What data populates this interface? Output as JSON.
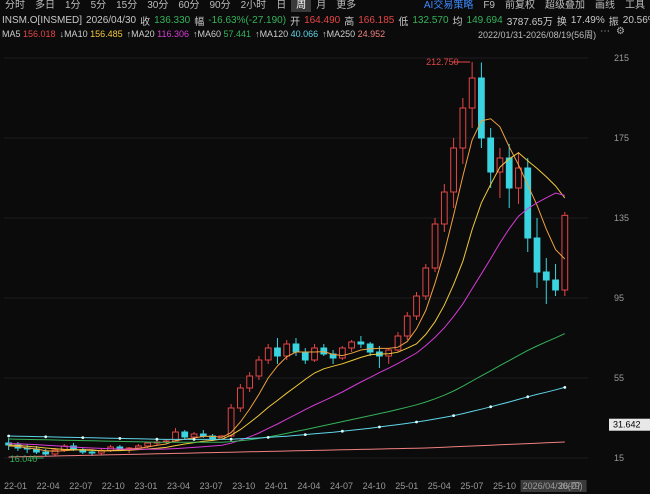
{
  "toolbar": {
    "tabs": [
      "分时",
      "多日",
      "1分",
      "5分",
      "15分",
      "30分",
      "60分",
      "90分",
      "2小时",
      "日",
      "周",
      "月",
      "更多"
    ],
    "active_tab": "周",
    "right": [
      "AI交易策略",
      "F9",
      "前复权",
      "超级叠加",
      "画线",
      "工具"
    ]
  },
  "quote": {
    "symbol": "INSM.O[INSMED]",
    "date": "2026/04/30",
    "close_label": "收",
    "close": "136.330",
    "change_label": "幅",
    "change": "-16.63%(-27.190)",
    "open_label": "开",
    "open": "164.490",
    "high_label": "高",
    "high": "166.185",
    "low_label": "低",
    "low": "132.570",
    "avg_label": "均",
    "avg": "149.694",
    "volume": "3787.65万",
    "turnover_label": "换",
    "turnover": "17.49%",
    "amplitude_label": "振",
    "amplitude": "20.56%"
  },
  "ma_legend": [
    {
      "label": "MA5",
      "value": "156.018",
      "arrow": "",
      "color": "#e54646"
    },
    {
      "label": "MA10",
      "value": "156.485",
      "arrow": "↓",
      "color": "#f0c93b"
    },
    {
      "label": "MA20",
      "value": "116.306",
      "arrow": "↑",
      "color": "#d63bd6"
    },
    {
      "label": "MA60",
      "value": "57.441",
      "arrow": "↑",
      "color": "#35b35a"
    },
    {
      "label": "MA120",
      "value": "40.066",
      "arrow": "↑",
      "color": "#5fd6e8"
    },
    {
      "label": "MA250",
      "value": "24.952",
      "arrow": "↑",
      "color": "#f08080"
    }
  ],
  "date_range": "2022/01/31-2026/08/19(56周)",
  "icons": [
    "more-icon",
    "settings-icon"
  ],
  "chart_data": {
    "type": "candlestick",
    "y_ticks": [
      "215",
      "175",
      "135",
      "95",
      "55",
      "15"
    ],
    "y_values": [
      215,
      175,
      135,
      95,
      55,
      15
    ],
    "ylim": [
      5,
      223
    ],
    "x_ticks": [
      "22-01",
      "22-04",
      "22-07",
      "22-10",
      "23-01",
      "23-04",
      "23-07",
      "23-10",
      "24-01",
      "24-04",
      "24-07",
      "24-10",
      "25-01",
      "25-04",
      "25-07",
      "25-10",
      "2026/04/30(四)",
      "26-07"
    ],
    "max_label": "212.750",
    "min_label": "16.040",
    "current_price_tag": "31.642",
    "candles": [
      [
        22.5,
        25,
        19,
        21.5
      ],
      [
        21.5,
        23,
        18.5,
        20
      ],
      [
        20,
        22,
        17.5,
        19.5
      ],
      [
        19.5,
        21,
        17,
        18
      ],
      [
        18,
        19.5,
        16,
        17
      ],
      [
        17,
        20,
        16.2,
        19
      ],
      [
        19,
        22,
        18,
        21
      ],
      [
        21,
        22.5,
        18.5,
        19.2
      ],
      [
        19.2,
        20.5,
        17,
        18
      ],
      [
        18,
        19,
        16.04,
        17.5
      ],
      [
        17.5,
        19.5,
        16.5,
        18.8
      ],
      [
        18.8,
        21.5,
        18,
        20.5
      ],
      [
        20.5,
        21.5,
        18.5,
        19
      ],
      [
        19,
        20.5,
        17.5,
        20
      ],
      [
        20,
        22,
        19,
        21
      ],
      [
        21,
        23,
        20,
        22.5
      ],
      [
        22.5,
        24,
        21,
        23
      ],
      [
        23,
        24.5,
        22,
        23.5
      ],
      [
        23.5,
        30,
        23,
        28
      ],
      [
        28,
        29,
        24,
        25.5
      ],
      [
        25.5,
        28,
        24.5,
        27
      ],
      [
        27,
        29,
        25,
        26
      ],
      [
        26,
        27,
        23.5,
        24.5
      ],
      [
        24.5,
        26.5,
        24,
        26
      ],
      [
        26,
        42,
        25.5,
        40
      ],
      [
        40,
        52,
        38,
        50
      ],
      [
        50,
        58,
        48,
        56
      ],
      [
        56,
        66,
        54,
        64
      ],
      [
        64,
        72,
        62,
        70
      ],
      [
        70,
        75,
        62,
        66
      ],
      [
        66,
        74,
        64,
        72
      ],
      [
        72,
        75,
        66,
        68
      ],
      [
        68,
        70,
        62,
        64
      ],
      [
        64,
        72,
        63,
        70
      ],
      [
        70,
        72,
        66,
        67
      ],
      [
        67,
        69,
        62,
        65
      ],
      [
        65,
        71,
        64,
        70
      ],
      [
        70,
        74,
        68,
        73
      ],
      [
        73,
        76,
        70,
        72
      ],
      [
        72,
        73,
        66,
        68
      ],
      [
        68,
        71,
        60,
        66
      ],
      [
        66,
        70,
        62,
        69
      ],
      [
        69,
        78,
        68,
        76
      ],
      [
        76,
        88,
        74,
        86
      ],
      [
        86,
        98,
        84,
        96
      ],
      [
        96,
        112,
        94,
        110
      ],
      [
        110,
        135,
        108,
        132
      ],
      [
        132,
        152,
        128,
        148
      ],
      [
        148,
        175,
        140,
        170
      ],
      [
        170,
        195,
        162,
        190
      ],
      [
        190,
        213,
        180,
        205
      ],
      [
        205,
        212.75,
        170,
        175
      ],
      [
        175,
        180,
        150,
        158
      ],
      [
        158,
        170,
        145,
        165
      ],
      [
        165,
        172,
        140,
        150
      ],
      [
        150,
        168,
        142,
        160
      ],
      [
        160,
        165,
        118,
        125
      ],
      [
        125,
        135,
        100,
        108
      ],
      [
        108,
        115,
        92,
        104
      ],
      [
        104,
        112,
        96,
        99
      ],
      [
        99,
        138,
        96,
        136.33
      ]
    ],
    "ma_lines": {
      "MA5": [
        21,
        20.8,
        20,
        19.5,
        18.6,
        18.4,
        18.6,
        19,
        19.2,
        19.1,
        18.5,
        18.7,
        19,
        19.5,
        19.8,
        20.5,
        21.4,
        22,
        23.7,
        24.4,
        25,
        25.8,
        25.9,
        25.3,
        27.7,
        33,
        39.5,
        46.8,
        55,
        61,
        65.6,
        68,
        68,
        68,
        68.2,
        66.8,
        66.2,
        67.4,
        69,
        69.6,
        69.8,
        69.8,
        70.4,
        73.2,
        79.6,
        88.8,
        102.4,
        117.8,
        136.4,
        156,
        174,
        183.6,
        184.6,
        180.6,
        170.6,
        161.6,
        151.6,
        141.4,
        129.4,
        119.2,
        114.5
      ],
      "MA10": [
        21.5,
        21.3,
        20.9,
        20.5,
        20,
        19.6,
        19.3,
        19.2,
        19,
        18.8,
        18.6,
        18.6,
        18.7,
        18.9,
        19.2,
        19.5,
        19.9,
        20.3,
        21.2,
        22,
        22.7,
        23.4,
        23.8,
        24.4,
        26.4,
        29.2,
        32.7,
        36.3,
        40.3,
        43.8,
        47.4,
        50.8,
        54.3,
        57.5,
        59.6,
        60.9,
        62.1,
        63.7,
        65.3,
        66.6,
        67,
        67.1,
        67.9,
        69.9,
        72.1,
        76.8,
        83.1,
        91.4,
        101.7,
        113.4,
        129.2,
        142.6,
        151.8,
        160.4,
        164.6,
        167.6,
        163.6,
        159.8,
        155.6,
        151,
        145
      ],
      "MA20": [
        22.2,
        22.1,
        21.9,
        21.7,
        21.4,
        21.1,
        20.8,
        20.5,
        20.2,
        20,
        19.8,
        19.6,
        19.5,
        19.4,
        19.4,
        19.4,
        19.4,
        19.5,
        19.7,
        20,
        20.3,
        20.6,
        21,
        21.4,
        22.4,
        23.9,
        25.6,
        27.5,
        29.8,
        32,
        34.4,
        36.8,
        39.2,
        41.5,
        43.6,
        45.8,
        48,
        50.5,
        53,
        55.3,
        57.7,
        59.9,
        62.3,
        64.9,
        67.5,
        71.2,
        75.3,
        80.1,
        85.8,
        92.1,
        99.6,
        107.1,
        114.7,
        122.5,
        129.6,
        135.9,
        139.7,
        142.6,
        145.1,
        147.5,
        146.3
      ],
      "MA60": [
        24.5,
        24.4,
        24.3,
        24.2,
        24.1,
        24,
        23.9,
        23.8,
        23.7,
        23.6,
        23.5,
        23.4,
        23.3,
        23.2,
        23.1,
        23,
        22.9,
        22.9,
        22.9,
        22.9,
        22.9,
        22.9,
        22.9,
        22.9,
        23.2,
        23.6,
        24.1,
        24.8,
        25.5,
        26.4,
        27.3,
        28.3,
        29.2,
        30.2,
        31.2,
        32.2,
        33.2,
        34.2,
        35.2,
        36.2,
        37.2,
        38.2,
        39.3,
        40.4,
        41.6,
        43,
        44.6,
        46.4,
        48.5,
        50.9,
        53.5,
        56.1,
        58.6,
        61.2,
        63.7,
        66.3,
        68.8,
        71,
        73.1,
        75.1,
        77.2
      ],
      "MA120": [
        26,
        25.9,
        25.8,
        25.7,
        25.6,
        25.5,
        25.4,
        25.3,
        25.2,
        25.1,
        25,
        24.9,
        24.8,
        24.7,
        24.6,
        24.5,
        24.4,
        24.3,
        24.3,
        24.3,
        24.3,
        24.3,
        24.3,
        24.3,
        24.4,
        24.6,
        24.8,
        25,
        25.3,
        25.6,
        25.9,
        26.3,
        26.7,
        27.1,
        27.5,
        27.9,
        28.4,
        28.9,
        29.4,
        29.9,
        30.5,
        31.1,
        31.7,
        32.3,
        33,
        33.7,
        34.5,
        35.3,
        36.2,
        37.2,
        38.3,
        39.4,
        40.6,
        41.8,
        43,
        44.3,
        45.6,
        46.8,
        47.9,
        49.1,
        50.3
      ],
      "MA250": [
        15.5,
        15.6,
        15.7,
        15.8,
        15.9,
        16,
        16.1,
        16.2,
        16.3,
        16.4,
        16.5,
        16.6,
        16.7,
        16.8,
        16.9,
        17,
        17.1,
        17.2,
        17.3,
        17.4,
        17.5,
        17.6,
        17.7,
        17.8,
        17.9,
        18,
        18.1,
        18.2,
        18.3,
        18.4,
        18.5,
        18.6,
        18.7,
        18.8,
        18.9,
        19,
        19.1,
        19.2,
        19.3,
        19.4,
        19.5,
        19.6,
        19.7,
        19.8,
        19.9,
        20,
        20.2,
        20.4,
        20.6,
        20.8,
        21,
        21.2,
        21.4,
        21.6,
        21.8,
        22,
        22.2,
        22.4,
        22.6,
        22.8,
        23
      ]
    }
  }
}
